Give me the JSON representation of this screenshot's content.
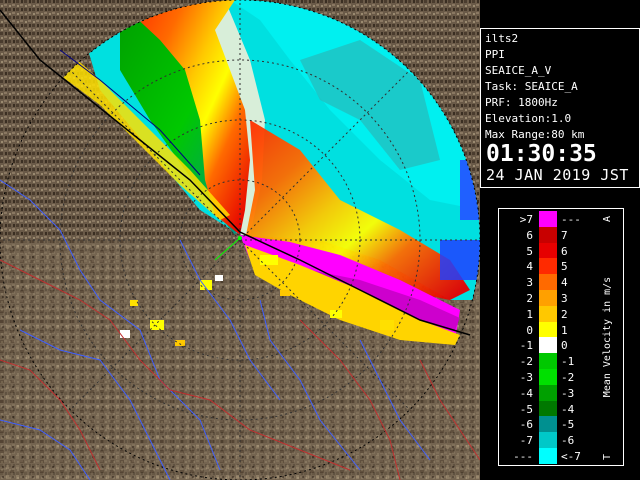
{
  "info": {
    "site": "ilts2",
    "mode": "PPI",
    "product": "SEAICE_A_V",
    "task": "Task: SEAICE_A",
    "prf": "PRF: 1800Hz",
    "elevation": "Elevation:1.0",
    "max_range": "Max Range:80 km",
    "time": "01:30:35",
    "date": "24 JAN 2019 JST"
  },
  "legend": {
    "title": "Mean Velocity in m/s",
    "top_marker": "A",
    "bottom_marker": "T",
    "rows": [
      {
        "left": ">7",
        "right": "---",
        "color": "#ff00ff"
      },
      {
        "left": "6",
        "right": "7",
        "color": "#c80000"
      },
      {
        "left": "5",
        "right": "6",
        "color": "#e60000"
      },
      {
        "left": "4",
        "right": "5",
        "color": "#ff2a00"
      },
      {
        "left": "3",
        "right": "4",
        "color": "#ff6a00"
      },
      {
        "left": "2",
        "right": "3",
        "color": "#ffa000"
      },
      {
        "left": "1",
        "right": "2",
        "color": "#ffc800"
      },
      {
        "left": "0",
        "right": "1",
        "color": "#ffff00"
      },
      {
        "left": "-1",
        "right": "0",
        "color": "#ffffff"
      },
      {
        "left": "-2",
        "right": "-1",
        "color": "#00c800"
      },
      {
        "left": "-3",
        "right": "-2",
        "color": "#00e000"
      },
      {
        "left": "-4",
        "right": "-3",
        "color": "#00a000"
      },
      {
        "left": "-5",
        "right": "-4",
        "color": "#007800"
      },
      {
        "left": "-6",
        "right": "-5",
        "color": "#009090"
      },
      {
        "left": "-7",
        "right": "-6",
        "color": "#00c8c8"
      },
      {
        "left": "---",
        "right": "<-7",
        "color": "#00ffff"
      }
    ]
  }
}
